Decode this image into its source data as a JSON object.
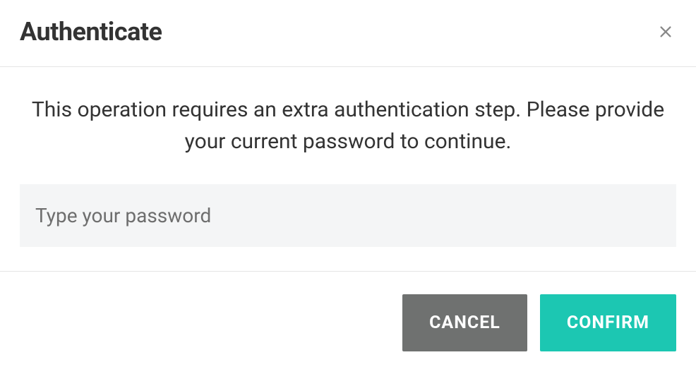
{
  "dialog": {
    "title": "Authenticate",
    "message": "This operation requires an extra authentication step. Please provide your current password to continue.",
    "password_placeholder": "Type your password",
    "password_value": "",
    "cancel_label": "CANCEL",
    "confirm_label": "CONFIRM"
  }
}
